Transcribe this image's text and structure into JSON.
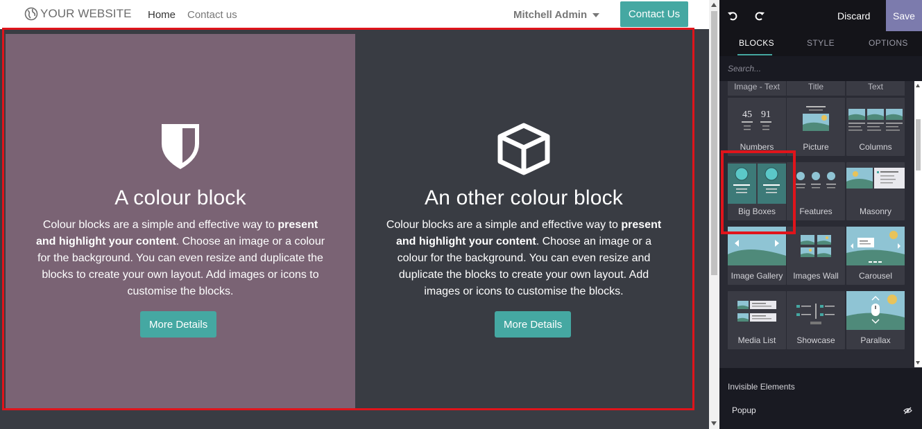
{
  "navbar": {
    "logo_text": "YOUR WEBSITE",
    "links": [
      "Home",
      "Contact us"
    ],
    "user": "Mitchell Admin",
    "cta": "Contact Us"
  },
  "blocks": [
    {
      "icon": "shield-icon",
      "title": "A colour block",
      "text_pre": "Colour blocks are a simple and effective way to ",
      "text_bold": "present and highlight your content",
      "text_post": ". Choose an image or a colour for the background. You can even resize and duplicate the blocks to create your own layout. Add images or icons to customise the blocks.",
      "button": "More Details",
      "bg": "#7a6374"
    },
    {
      "icon": "cube-icon",
      "title": "An other colour block",
      "text_pre": "Colour blocks are a simple and effective way to ",
      "text_bold": "present and highlight your content",
      "text_post": ". Choose an image or a colour for the background. You can even resize and duplicate the blocks to create your own layout. Add images or icons to customise the blocks.",
      "button": "More Details",
      "bg": "#393c43"
    }
  ],
  "editor": {
    "discard": "Discard",
    "save": "Save",
    "tabs": [
      "BLOCKS",
      "STYLE",
      "OPTIONS"
    ],
    "active_tab": "BLOCKS",
    "search_placeholder": "Search...",
    "partial_row": [
      "Image - Text",
      "Title",
      "Text"
    ],
    "snippets": [
      [
        "Numbers",
        "Picture",
        "Columns"
      ],
      [
        "Big Boxes",
        "Features",
        "Masonry"
      ],
      [
        "Image Gallery",
        "Images Wall",
        "Carousel"
      ],
      [
        "Media List",
        "Showcase",
        "Parallax"
      ]
    ],
    "numbers_art": [
      "45",
      "91"
    ],
    "highlighted": "Big Boxes",
    "invisible_title": "Invisible Elements",
    "invisible_items": [
      "Popup"
    ]
  },
  "colors": {
    "accent": "#45a8a2",
    "save": "#7c7bad",
    "highlight": "#e0141b"
  }
}
